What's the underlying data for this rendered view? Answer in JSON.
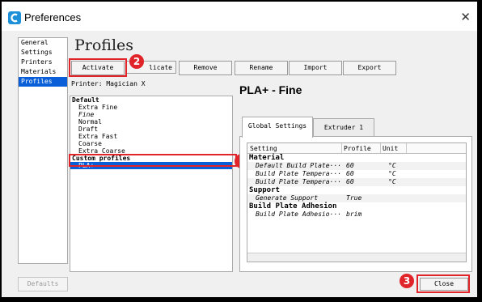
{
  "window": {
    "title": "Preferences",
    "close_glyph": "✕"
  },
  "nav": {
    "items": [
      {
        "label": "General"
      },
      {
        "label": "Settings"
      },
      {
        "label": "Printers"
      },
      {
        "label": "Materials"
      },
      {
        "label": "Profiles",
        "selected": true
      }
    ]
  },
  "page": {
    "heading": "Profiles"
  },
  "toolbar": {
    "activate_label": "Activate",
    "duplicate_label": "licate",
    "remove_label": "Remove",
    "rename_label": "Rename",
    "import_label": "Import",
    "export_label": "Export"
  },
  "printer_label": "Printer: Magician X",
  "profile_list": {
    "default_group": "Default",
    "default_items": [
      "Extra Fine",
      "Fine",
      "Normal",
      "Draft",
      "Extra Fast",
      "Coarse",
      "Extra Coarse"
    ],
    "custom_group": "Custom profiles",
    "custom_items": [
      "PLA+"
    ]
  },
  "profile_detail": {
    "title": "PLA+ - Fine",
    "tabs": [
      {
        "label": "Global Settings",
        "active": true
      },
      {
        "label": "Extruder 1",
        "active": false
      }
    ],
    "columns": {
      "setting": "Setting",
      "profile": "Profile",
      "unit": "Unit"
    },
    "groups": [
      {
        "name": "Material",
        "rows": [
          {
            "setting": "Default Build Plate···",
            "profile": "60",
            "unit": "°C"
          },
          {
            "setting": "Build Plate Tempera···",
            "profile": "60",
            "unit": "°C"
          },
          {
            "setting": "Build Plate Tempera···",
            "profile": "60",
            "unit": "°C"
          }
        ]
      },
      {
        "name": "Support",
        "rows": [
          {
            "setting": "Generate Support",
            "profile": "True",
            "unit": ""
          }
        ]
      },
      {
        "name": "Build Plate Adhesion",
        "rows": [
          {
            "setting": "Build Plate Adhesio···",
            "profile": "brim",
            "unit": ""
          }
        ]
      }
    ]
  },
  "footer": {
    "defaults_label": "Defaults",
    "close_label": "Close"
  },
  "annotations": {
    "badge_1": "1",
    "badge_2": "2",
    "badge_3": "3",
    "highlight_color": "#e0242a"
  },
  "colors": {
    "selection": "#0a5fd8",
    "app_icon": "#1e90d8"
  }
}
